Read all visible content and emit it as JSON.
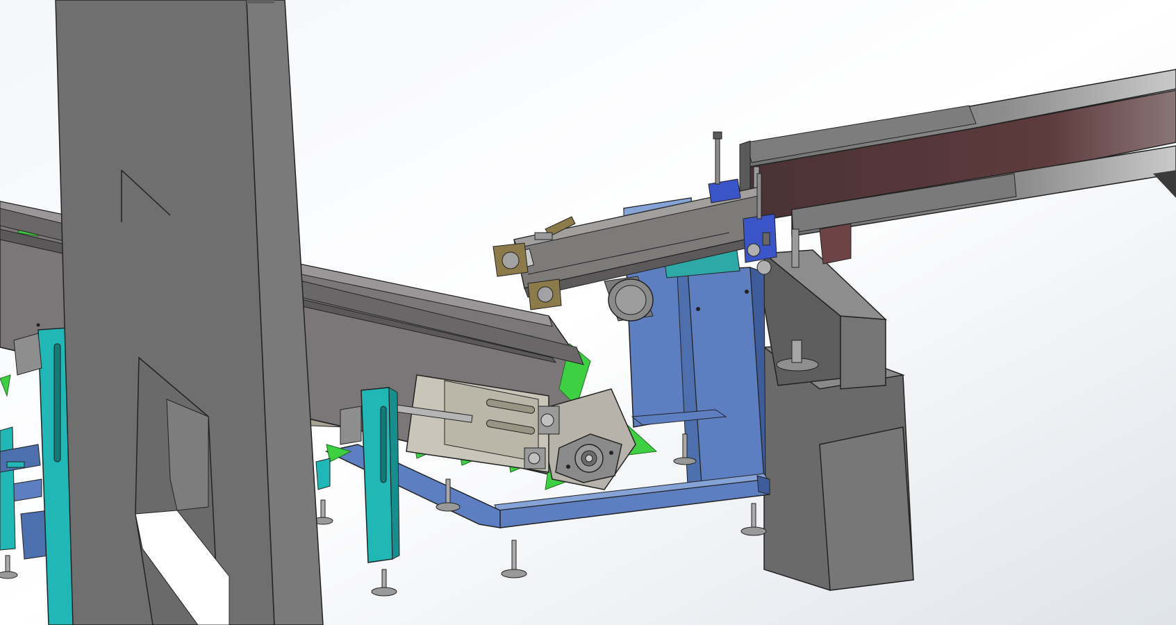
{
  "view": {
    "type": "3D CAD assembly render",
    "background_colors": [
      "#f4f6fa",
      "#ffffff",
      "#dfe3ea"
    ]
  },
  "components": [
    {
      "name": "support-tower",
      "color": "#6f6f6f"
    },
    {
      "name": "inclined-cleated-conveyor",
      "color": "#7b7778",
      "cleat_color": "#3fcf43"
    },
    {
      "name": "cyan-support-posts",
      "color": "#22b7b7"
    },
    {
      "name": "blue-base-frame",
      "color": "#5d7fc1"
    },
    {
      "name": "tensioner-bracket",
      "color": "#c9c5b8"
    },
    {
      "name": "flange-bearing",
      "color": "#8a8a8a"
    },
    {
      "name": "upper-short-conveyor",
      "color": "#7d7a7a"
    },
    {
      "name": "drive-motor",
      "color": "#7a7a7a"
    },
    {
      "name": "feed-chute",
      "color": "#5e3b3d"
    },
    {
      "name": "support-block",
      "color": "#6a6a6a"
    },
    {
      "name": "leveling-feet",
      "color": "#9a9a9a"
    }
  ]
}
